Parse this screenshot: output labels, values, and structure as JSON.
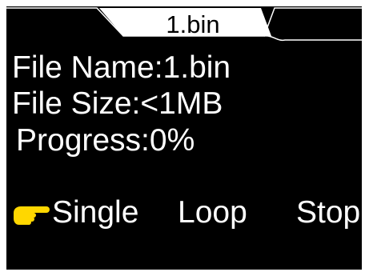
{
  "tab": {
    "title": "1.bin"
  },
  "file_info": {
    "name_line": "File Name:1.bin",
    "size_line": "File Size:<1MB",
    "progress_line": "Progress:0%"
  },
  "progress": {
    "value": 0
  },
  "modes": {
    "selected": "Single",
    "items": [
      {
        "label": "Single"
      },
      {
        "label": "Loop"
      },
      {
        "label": "Stop"
      }
    ]
  },
  "icons": {
    "pointer": "pointing-hand-icon"
  },
  "colors": {
    "background": "#000000",
    "text": "#ffffff",
    "tab_fill": "#ffffff",
    "pointer": "#ffd700"
  }
}
